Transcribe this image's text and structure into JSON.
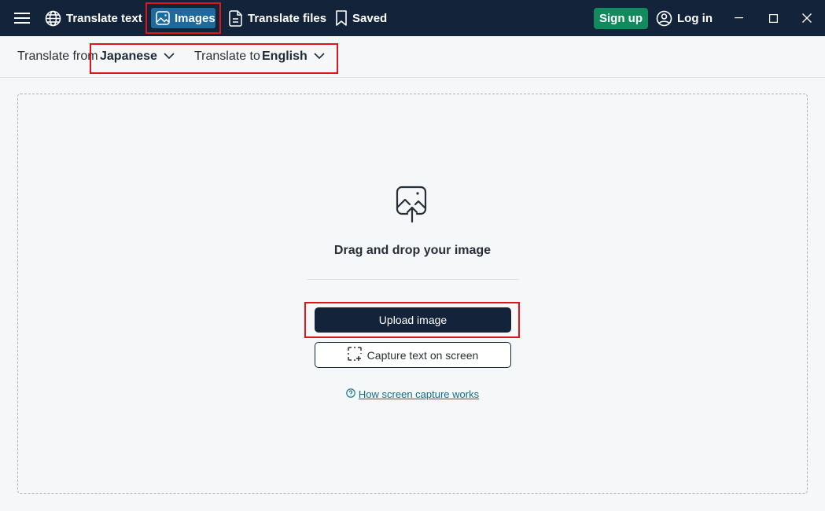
{
  "nav": {
    "translate_text": "Translate text",
    "images": "Images",
    "translate_files": "Translate files",
    "saved": "Saved",
    "sign_up": "Sign up",
    "log_in": "Log in"
  },
  "language": {
    "from_label": "Translate from",
    "from_value": "Japanese",
    "to_label": "Translate to",
    "to_value": "English"
  },
  "dropzone": {
    "drag_text": "Drag and drop your image",
    "upload_button": "Upload image",
    "capture_button": "Capture text on screen",
    "help_link": "How screen capture works"
  },
  "colors": {
    "nav_bg": "#12233a",
    "active_tab": "#1e6a9c",
    "signup_bg": "#138a5e",
    "highlight": "#e0141b",
    "link": "#0f6c8a"
  }
}
